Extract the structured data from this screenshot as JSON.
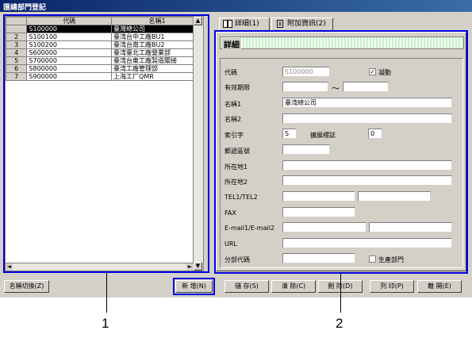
{
  "window": {
    "title": "匯總部門登記"
  },
  "grid": {
    "columns": [
      "代碼",
      "名稱1"
    ],
    "rows": [
      {
        "num": "",
        "code": "S100000",
        "name": "臺灣總公司",
        "selected": true
      },
      {
        "num": "2",
        "code": "S100100",
        "name": "臺湾台中工廠BU1"
      },
      {
        "num": "3",
        "code": "S100200",
        "name": "臺湾台南工廠BU2"
      },
      {
        "num": "4",
        "code": "S600000",
        "name": "臺湾臺北工廠營業部"
      },
      {
        "num": "5",
        "code": "S700000",
        "name": "臺湾台東工廠製造關接"
      },
      {
        "num": "6",
        "code": "S800000",
        "name": "臺湾工廠管理部"
      },
      {
        "num": "7",
        "code": "S900000",
        "name": "上海工厂QMR"
      }
    ]
  },
  "tabs": {
    "detail": "詳細(1)",
    "additional": "附加資訊(2)"
  },
  "section_title": "詳細",
  "form": {
    "code_label": "代碼",
    "code_value": "S100000",
    "fixed_label": "凝動",
    "fixed_checked": "✓",
    "valid_label": "有效期限",
    "tilde": "〜",
    "name1_label": "名稱1",
    "name1_value": "臺湾總公司",
    "name2_label": "名稱2",
    "index_label": "索引字",
    "index_value": "S",
    "ext_label": "擴展標誌",
    "ext_value": "0",
    "postal_label": "郵遞區號",
    "addr1_label": "所在地1",
    "addr2_label": "所在地2",
    "tel_label": "TEL1/TEL2",
    "fax_label": "FAX",
    "email_label": "E-mail1/E-mail2",
    "url_label": "URL",
    "dept_code_label": "分部代碼",
    "prod_dept_label": "生產部門"
  },
  "buttons": {
    "name_switch": "名稱切換(Z)",
    "new": "新 增(N)",
    "save": "儲 存(S)",
    "clear": "清 除(C)",
    "delete": "刪 除(D)",
    "print": "列 印(P)",
    "close": "離 開(E)"
  },
  "callouts": {
    "one": "1",
    "two": "2"
  },
  "colors": {
    "highlight": "#0000e0",
    "title_bar": "#0a246a",
    "section_pattern": "#c8f0c8"
  },
  "icons": {
    "detail_tab": "book-icon",
    "additional_tab": "document-icon"
  }
}
